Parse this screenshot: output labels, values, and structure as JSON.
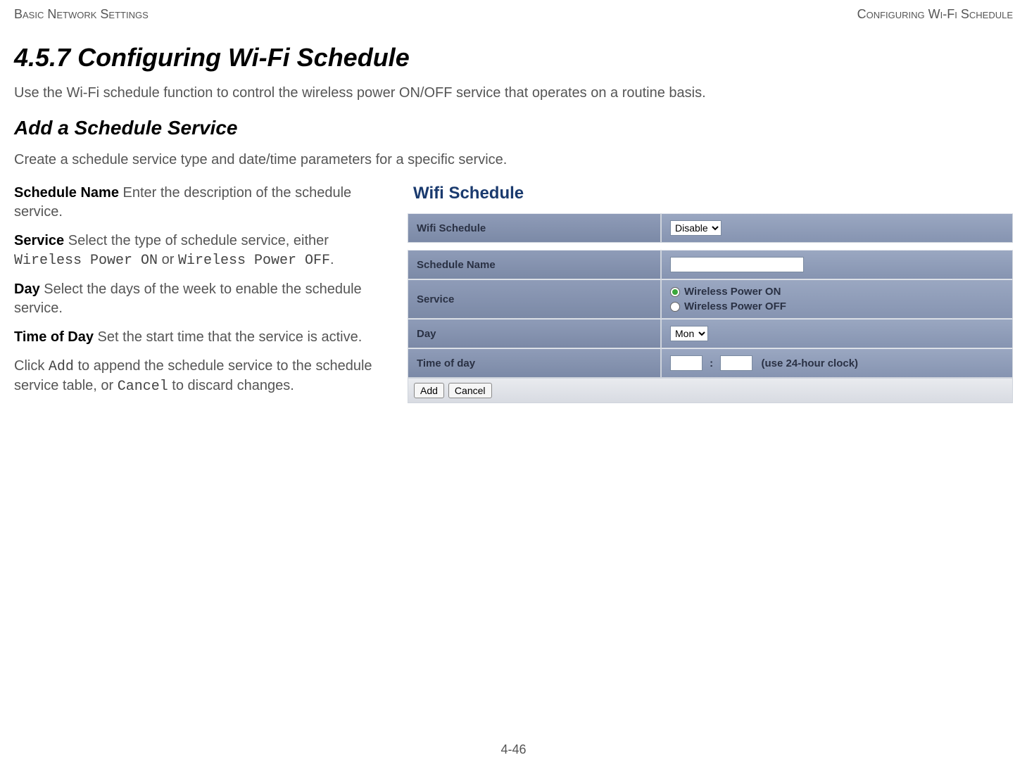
{
  "header": {
    "left": "Basic Network Settings",
    "right": "Configuring Wi-Fi Schedule"
  },
  "section": {
    "number_title": "4.5.7 Configuring Wi-Fi Schedule",
    "intro": "Use the Wi-Fi schedule function to control the wireless power ON/OFF service that operates on a routine basis."
  },
  "subsection": {
    "title": "Add a Schedule Service",
    "intro": "Create a schedule service type and date/time parameters for a specific service."
  },
  "definitions": {
    "schedule_name": {
      "term": "Schedule Name",
      "text": " Enter the description of the schedule service."
    },
    "service": {
      "term": "Service",
      "text_before": " Select the type of schedule service, either ",
      "opt1": "Wireless Power ON",
      "mid": " or ",
      "opt2": "Wireless Power OFF",
      "after": "."
    },
    "day": {
      "term": "Day",
      "text": " Select the days of the week to enable the schedule service."
    },
    "time_of_day": {
      "term": "Time of Day",
      "text": " Set the start time that the service is active."
    },
    "click_note": {
      "before": "Click ",
      "add": "Add",
      "mid": " to append the schedule service to the sched­ule service table, or ",
      "cancel": "Cancel",
      "after": " to discard changes."
    }
  },
  "panel": {
    "title": "Wifi Schedule",
    "rows": {
      "wifi_schedule": {
        "label": "Wifi Schedule",
        "value": "Disable"
      },
      "schedule_name": {
        "label": "Schedule Name",
        "value": ""
      },
      "service": {
        "label": "Service",
        "option_on": "Wireless Power ON",
        "option_off": "Wireless Power OFF"
      },
      "day": {
        "label": "Day",
        "value": "Mon"
      },
      "time_of_day": {
        "label": "Time of day",
        "hour": "",
        "minute": "",
        "separator": ":",
        "note": "(use 24-hour clock)"
      }
    },
    "buttons": {
      "add": "Add",
      "cancel": "Cancel"
    }
  },
  "footer": {
    "page": "4-46"
  }
}
